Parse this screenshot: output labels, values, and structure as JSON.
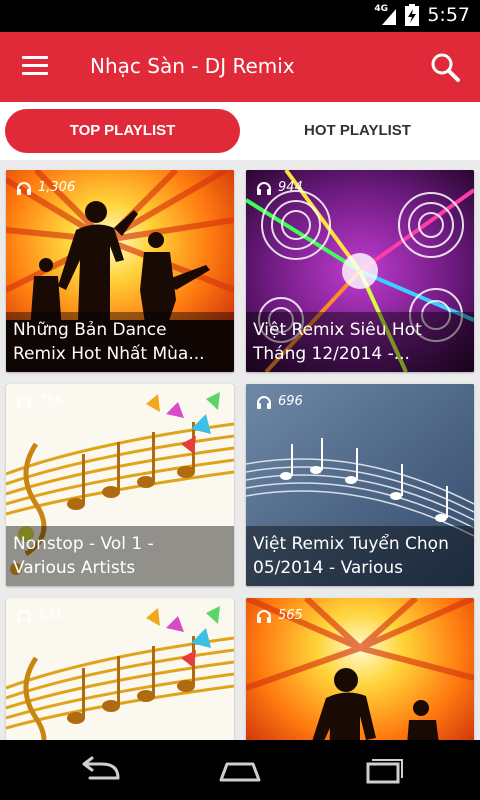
{
  "status_bar": {
    "network": "4G",
    "time": "5:57"
  },
  "app_bar": {
    "title": "Nhạc Sàn - DJ Remix",
    "menu_icon": "menu-icon",
    "search_icon": "search-icon"
  },
  "tabs": [
    {
      "label": "TOP PLAYLIST",
      "selected": true
    },
    {
      "label": "HOT PLAYLIST",
      "selected": false
    }
  ],
  "playlists": [
    {
      "listens": "1,306",
      "title": "Những Bản Dance\nRemix Hot Nhất Mùa..."
    },
    {
      "listens": "944",
      "title": "Việt Remix Siêu Hot\nTháng 12/2014   -..."
    },
    {
      "listens": "756",
      "title": "Nonstop - Vol 1 -\nVarious  Artists"
    },
    {
      "listens": "696",
      "title": "Việt Remix Tuyển Chọn\n05/2014 - Various"
    },
    {
      "listens": "621",
      "title": ""
    },
    {
      "listens": "565",
      "title": ""
    }
  ],
  "colors": {
    "accent": "#e02a3a",
    "background": "#ebebeb"
  },
  "nav_bar": {
    "back_icon": "back-icon",
    "home_icon": "home-icon",
    "recents_icon": "recents-icon"
  }
}
